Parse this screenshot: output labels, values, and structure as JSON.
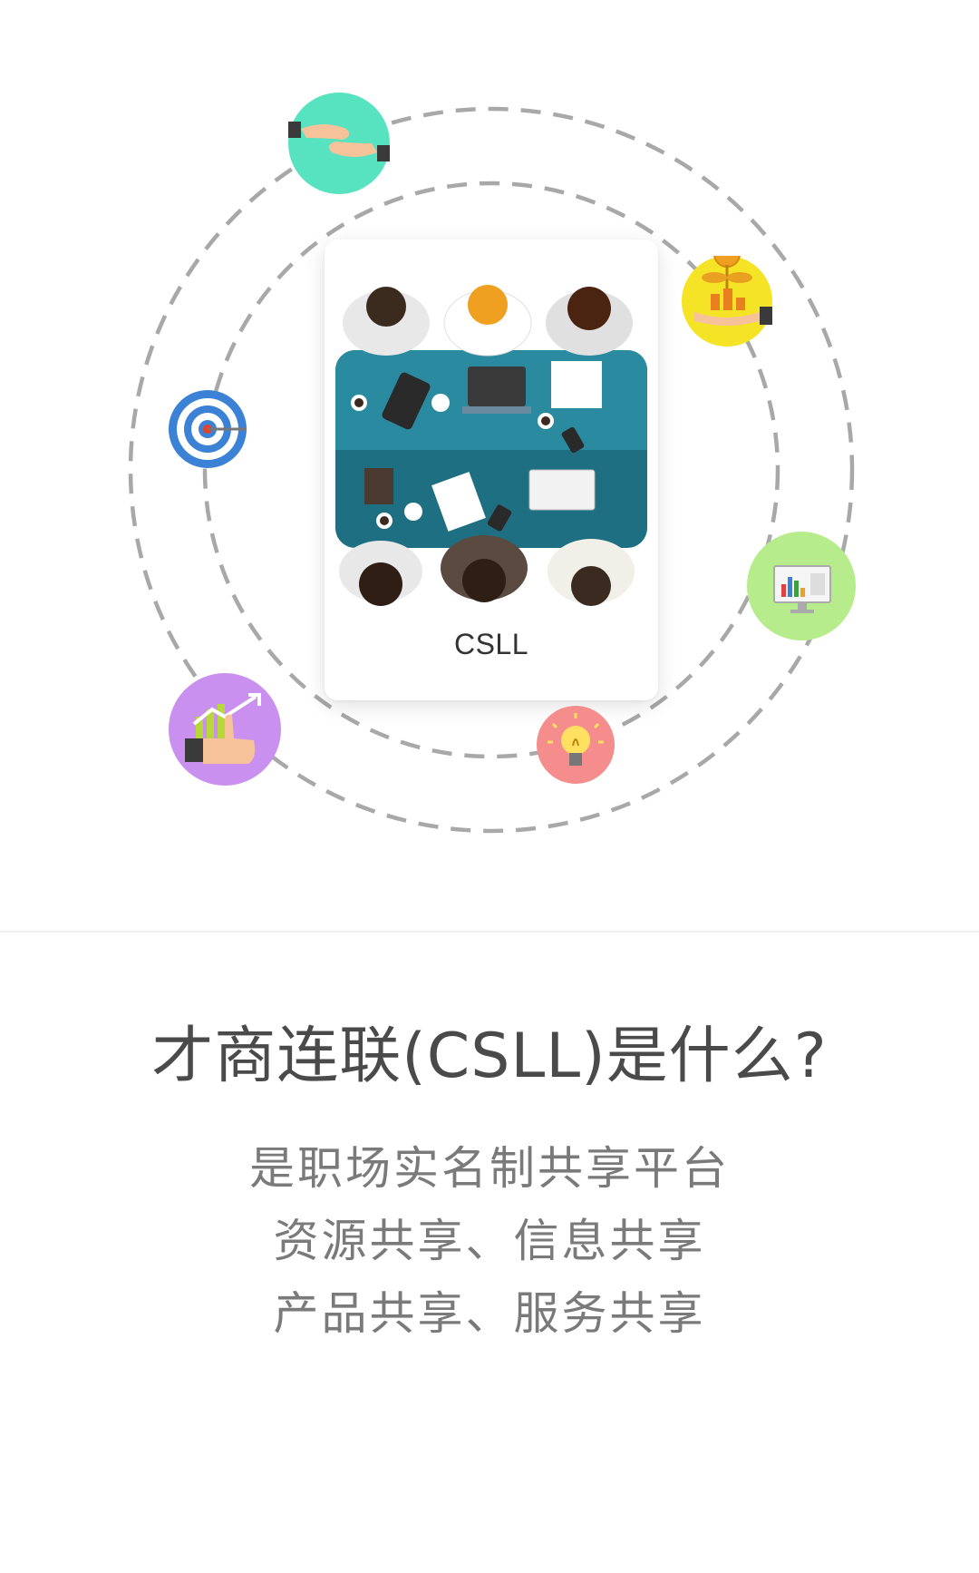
{
  "hero": {
    "card_label": "CSLL",
    "orbit_color": "#a8a8a8",
    "icons": [
      {
        "name": "handshake-icon",
        "color": "#57e2c0"
      },
      {
        "name": "money-plant-icon",
        "color": "#f5e326"
      },
      {
        "name": "target-dart-icon",
        "color": "#3b82d6"
      },
      {
        "name": "monitor-chart-icon",
        "color": "#b7ec8c"
      },
      {
        "name": "thumbs-up-growth-icon",
        "color": "#c990f0"
      },
      {
        "name": "lightbulb-icon",
        "color": "#f58d8d"
      }
    ]
  },
  "intro": {
    "title": "才商连联(CSLL)是什么?",
    "lines": [
      "是职场实名制共享平台",
      "资源共享、信息共享",
      "产品共享、服务共享"
    ]
  }
}
